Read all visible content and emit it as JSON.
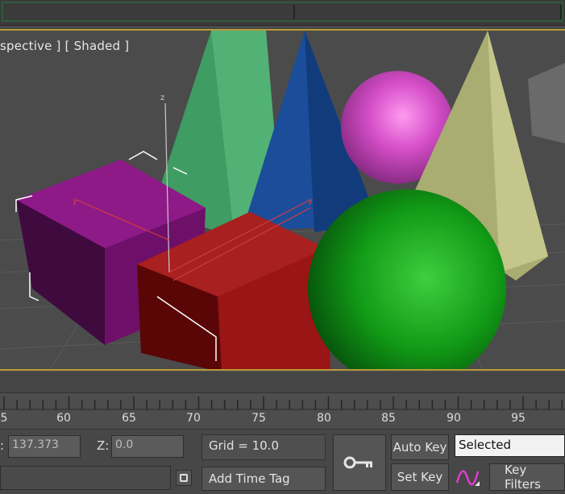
{
  "viewport": {
    "label": "spective ] [ Shaded ]",
    "axis_z": "z",
    "axis_y1": "y",
    "axis_y2": "y"
  },
  "timeline": {
    "ticks": [
      "5",
      "60",
      "65",
      "70",
      "75",
      "80",
      "85",
      "90",
      "95"
    ]
  },
  "status": {
    "x_value": "137.373",
    "z_label": "Z:",
    "z_value": "0.0",
    "grid_text": "Grid = 10.0",
    "add_time_tag": "Add Time Tag",
    "auto_key": "Auto Key",
    "set_key": "Set Key",
    "selected": "Selected",
    "key_filters": "Key Filters"
  },
  "icons": {
    "key": "key-icon",
    "curve": "curve-editor-icon",
    "lock": "selection-lock-icon"
  },
  "colors": {
    "viewport_border": "#b79a36",
    "background": "#4b4b4b"
  }
}
